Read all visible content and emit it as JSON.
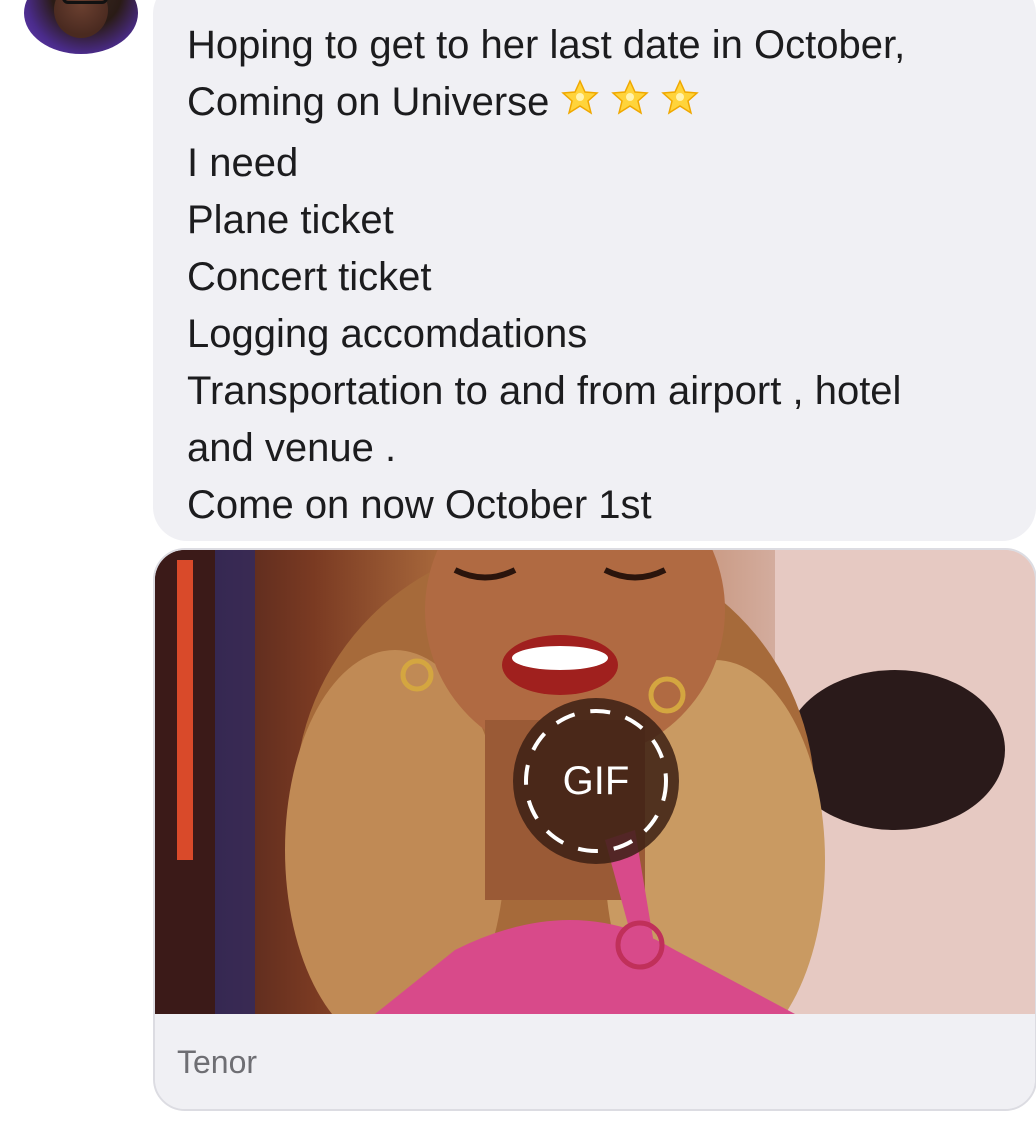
{
  "message": {
    "lines": [
      "Hoping to get to  her last date in October,",
      "Coming on Universe",
      "I need",
      "Plane ticket",
      "Concert ticket",
      "Logging accomdations",
      "Transportation to and from airport , hotel",
      "and venue .",
      "Come on now October 1st"
    ],
    "emoji": "🌟🌟🌟"
  },
  "gif": {
    "badge_label": "GIF",
    "source": "Tenor"
  },
  "colors": {
    "bubble": "#f0f0f4",
    "text": "#1c1c1e",
    "source_text": "#6e6e73"
  }
}
